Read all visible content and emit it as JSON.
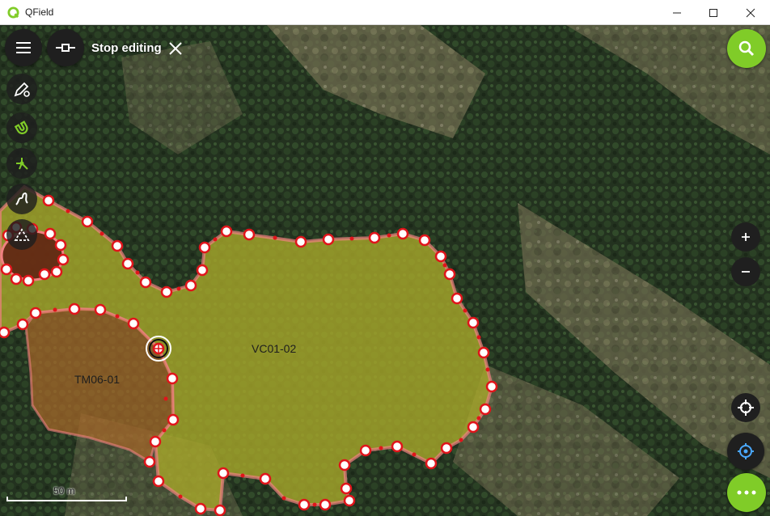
{
  "window": {
    "title": "QField",
    "minimize": "minimize",
    "maximize": "maximize",
    "close": "close"
  },
  "toolbar": {
    "stop_editing_label": "Stop editing"
  },
  "features": [
    {
      "label": "VC01-02"
    },
    {
      "label": "TM06-01"
    }
  ],
  "scale": {
    "label": "50 m"
  },
  "colors": {
    "accent": "#80cc28",
    "vertex": "#e0151b",
    "polygon_vc": "#a8a82a",
    "polygon_tm": "#a86a2a",
    "button_dark": "#1f1f1f"
  },
  "icons": {
    "menu": "menu-icon",
    "digitize": "line-node-icon",
    "search": "search-icon",
    "zoom_in": "plus-icon",
    "zoom_out": "minus-icon",
    "gps": "crosshair-icon",
    "locate": "locate-icon",
    "more": "more-icon",
    "edit_settings": "pencil-gear-icon",
    "snapping": "magnet-icon",
    "topology": "topology-icon",
    "freehand": "freehand-icon",
    "geometry": "triangle-icon"
  }
}
